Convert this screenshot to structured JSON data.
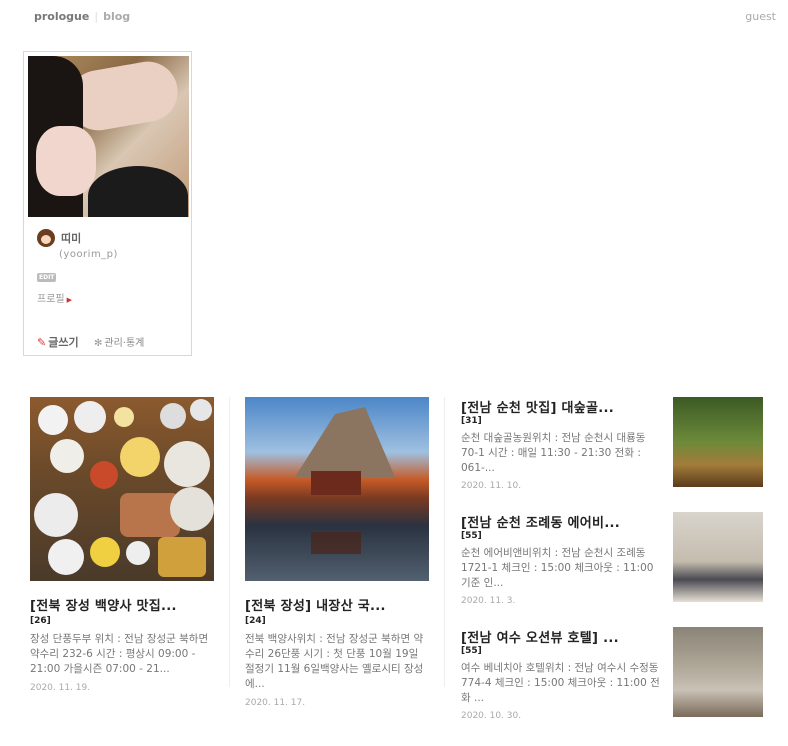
{
  "topnav": {
    "prologue": "prologue",
    "blog": "blog",
    "guest": "guest"
  },
  "profile": {
    "nickname": "띠미",
    "user_id": "(yoorim_p)",
    "edit_badge": "EDIT",
    "profile_link": "프로필",
    "write_label": "글쓰기",
    "manage_label": "관리·통계"
  },
  "posts": [
    {
      "title": "[전북 장성 백양사 맛집...",
      "count": "[26]",
      "excerpt": "장성 단풍두부 위치 : 전남 장성군 북하면 약수리 232-6 시간 : 평상시 09:00 - 21:00 가을시즌 07:00 - 21...",
      "date": "2020. 11. 19."
    },
    {
      "title": "[전북 장성] 내장산 국...",
      "count": "[24]",
      "excerpt": "전북 백양사위치 : 전남 장성군 북하면 약수리 26단풍 시기 : 첫 단풍 10월 19일 절정기 11월 6일백양사는 옐로시티 장성에...",
      "date": "2020. 11. 17."
    }
  ],
  "side_posts": [
    {
      "title": "[전남 순천 맛집] 대숲골...",
      "count": "[31]",
      "excerpt": "순천 대숲골농원위치 : 전남 순천시 대룡동 70-1 시간 : 매일 11:30 - 21:30 전화 : 061-...",
      "date": "2020. 11. 10."
    },
    {
      "title": "[전남 순천 조례동 에어비...",
      "count": "[55]",
      "excerpt": "순천 에어비앤비위치 : 전남 순천시 조례동 1721-1 체크인 : 15:00 체크아웃 : 11:00 기준 인...",
      "date": "2020. 11. 3."
    },
    {
      "title": "[전남 여수 오션뷰 호텔] ...",
      "count": "[55]",
      "excerpt": "여수 베네치아 호텔위치 : 전남 여수시 수정동 774-4 체크인 : 15:00 체크아웃 : 11:00 전화 ...",
      "date": "2020. 10. 30."
    }
  ]
}
